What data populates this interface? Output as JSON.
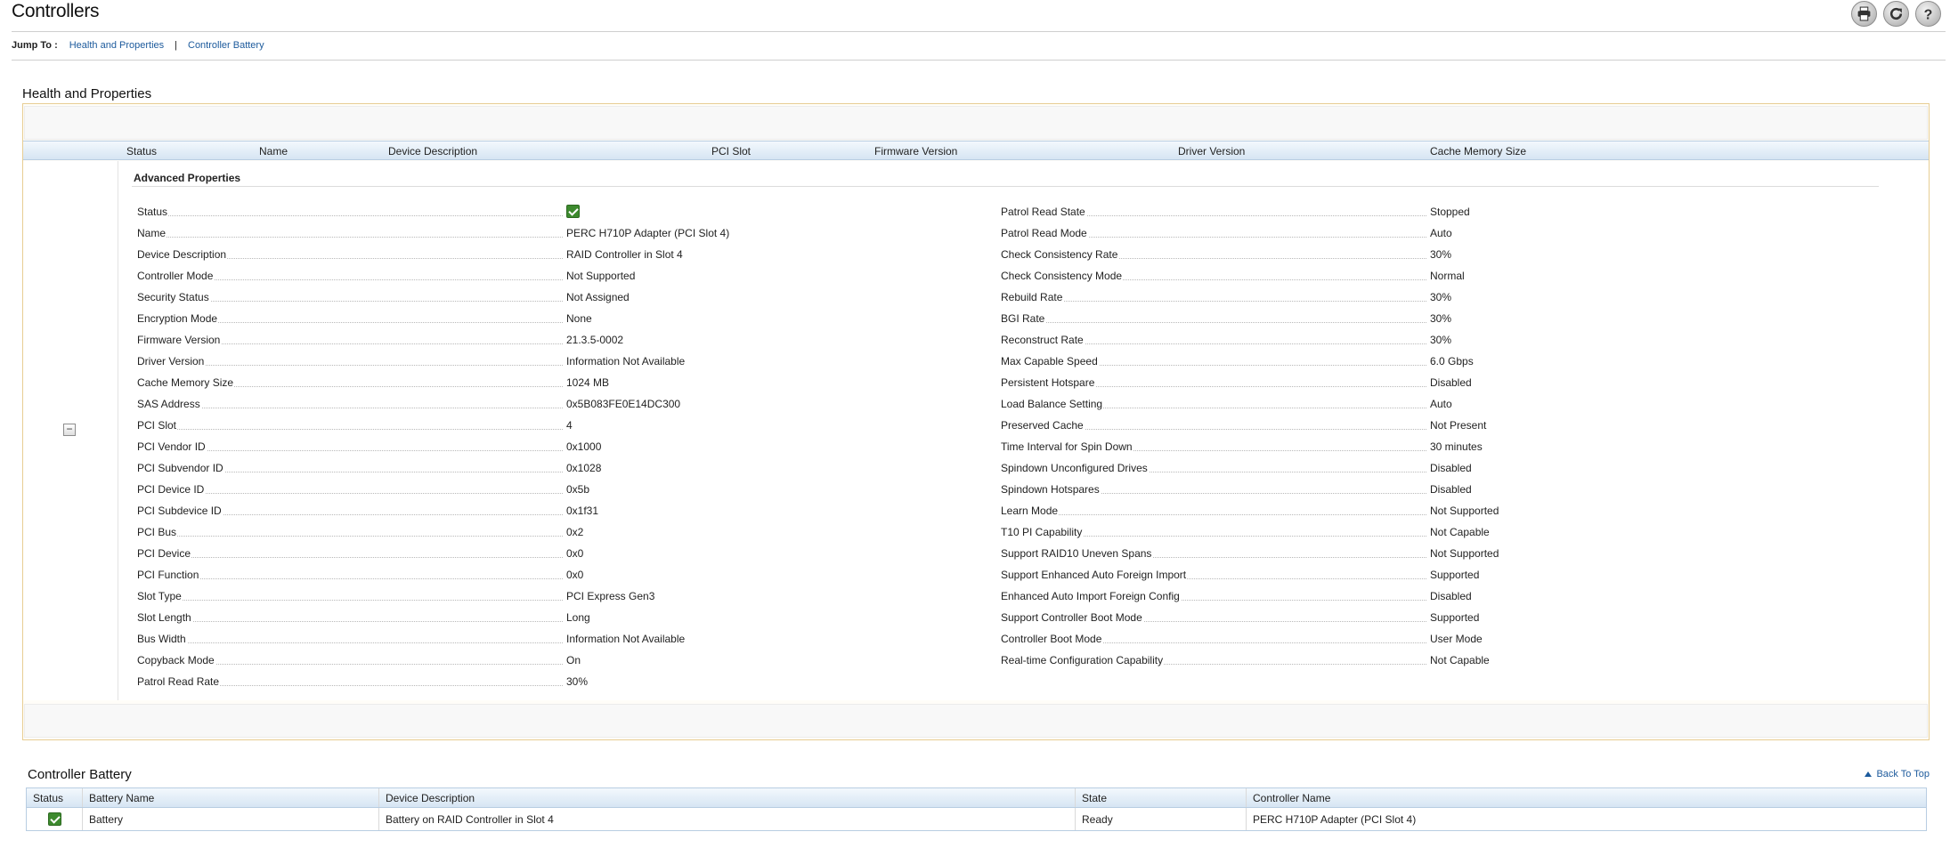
{
  "page": {
    "title": "Controllers"
  },
  "toolbar": {
    "print_icon": "printer-icon",
    "refresh_icon": "refresh-icon",
    "help_icon": "help-icon"
  },
  "jump": {
    "label": "Jump To :",
    "link1": "Health and Properties",
    "separator": "|",
    "link2": "Controller Battery"
  },
  "health": {
    "title": "Health and Properties",
    "columns": [
      "Status",
      "Name",
      "Device Description",
      "PCI Slot",
      "Firmware Version",
      "Driver Version",
      "Cache Memory Size"
    ],
    "expander": "−",
    "advanced_title": "Advanced Properties",
    "left_props": [
      {
        "k": "Status",
        "v": "",
        "icon": "status-ok-icon"
      },
      {
        "k": "Name",
        "v": "PERC H710P Adapter (PCI Slot 4)"
      },
      {
        "k": "Device Description",
        "v": "RAID Controller in Slot 4"
      },
      {
        "k": "Controller Mode",
        "v": "Not Supported"
      },
      {
        "k": "Security Status",
        "v": "Not Assigned"
      },
      {
        "k": "Encryption Mode",
        "v": "None"
      },
      {
        "k": "Firmware Version",
        "v": "21.3.5-0002"
      },
      {
        "k": "Driver Version",
        "v": "Information Not Available"
      },
      {
        "k": "Cache Memory Size",
        "v": "1024 MB"
      },
      {
        "k": "SAS Address",
        "v": "0x5B083FE0E14DC300"
      },
      {
        "k": "PCI Slot",
        "v": "4"
      },
      {
        "k": "PCI Vendor ID",
        "v": "0x1000"
      },
      {
        "k": "PCI Subvendor ID",
        "v": "0x1028"
      },
      {
        "k": "PCI Device ID",
        "v": "0x5b"
      },
      {
        "k": "PCI Subdevice ID",
        "v": "0x1f31"
      },
      {
        "k": "PCI Bus",
        "v": "0x2"
      },
      {
        "k": "PCI Device",
        "v": "0x0"
      },
      {
        "k": "PCI Function",
        "v": "0x0"
      },
      {
        "k": "Slot Type",
        "v": "PCI Express Gen3"
      },
      {
        "k": "Slot Length",
        "v": "Long"
      },
      {
        "k": "Bus Width",
        "v": "Information Not Available"
      },
      {
        "k": "Copyback Mode",
        "v": "On"
      },
      {
        "k": "Patrol Read Rate",
        "v": "30%"
      }
    ],
    "right_props": [
      {
        "k": "Patrol Read State",
        "v": "Stopped"
      },
      {
        "k": "Patrol Read Mode",
        "v": "Auto"
      },
      {
        "k": "Check Consistency Rate",
        "v": "30%"
      },
      {
        "k": "Check Consistency Mode",
        "v": "Normal"
      },
      {
        "k": "Rebuild Rate",
        "v": "30%"
      },
      {
        "k": "BGI Rate",
        "v": "30%"
      },
      {
        "k": "Reconstruct Rate",
        "v": "30%"
      },
      {
        "k": "Max Capable Speed",
        "v": "6.0 Gbps"
      },
      {
        "k": "Persistent Hotspare",
        "v": "Disabled"
      },
      {
        "k": "Load Balance Setting",
        "v": "Auto"
      },
      {
        "k": "Preserved Cache",
        "v": "Not Present"
      },
      {
        "k": "Time Interval for Spin Down",
        "v": "30 minutes"
      },
      {
        "k": "Spindown Unconfigured Drives",
        "v": "Disabled"
      },
      {
        "k": "Spindown Hotspares",
        "v": "Disabled"
      },
      {
        "k": "Learn Mode",
        "v": "Not Supported"
      },
      {
        "k": "T10 PI Capability",
        "v": "Not Capable"
      },
      {
        "k": "Support RAID10 Uneven Spans",
        "v": "Not Supported"
      },
      {
        "k": "Support Enhanced Auto Foreign Import",
        "v": "Supported"
      },
      {
        "k": "Enhanced Auto Import Foreign Config",
        "v": "Disabled"
      },
      {
        "k": "Support Controller Boot Mode",
        "v": "Supported"
      },
      {
        "k": "Controller Boot Mode",
        "v": "User Mode"
      },
      {
        "k": "Real-time Configuration Capability",
        "v": "Not Capable"
      }
    ]
  },
  "battery": {
    "title": "Controller Battery",
    "back_to_top": "Back To Top",
    "columns": [
      "Status",
      "Battery Name",
      "Device Description",
      "State",
      "Controller Name"
    ],
    "rows": [
      {
        "status_icon": "status-ok-icon",
        "name": "Battery",
        "description": "Battery on RAID Controller in Slot 4",
        "state": "Ready",
        "controller": "PERC H710P Adapter (PCI Slot 4)"
      }
    ]
  },
  "colors": {
    "link": "#1c5a9c",
    "panel_border": "#e7cd93",
    "header_gradient": "#d6e5f3",
    "status_ok": "#3d8a2e"
  }
}
